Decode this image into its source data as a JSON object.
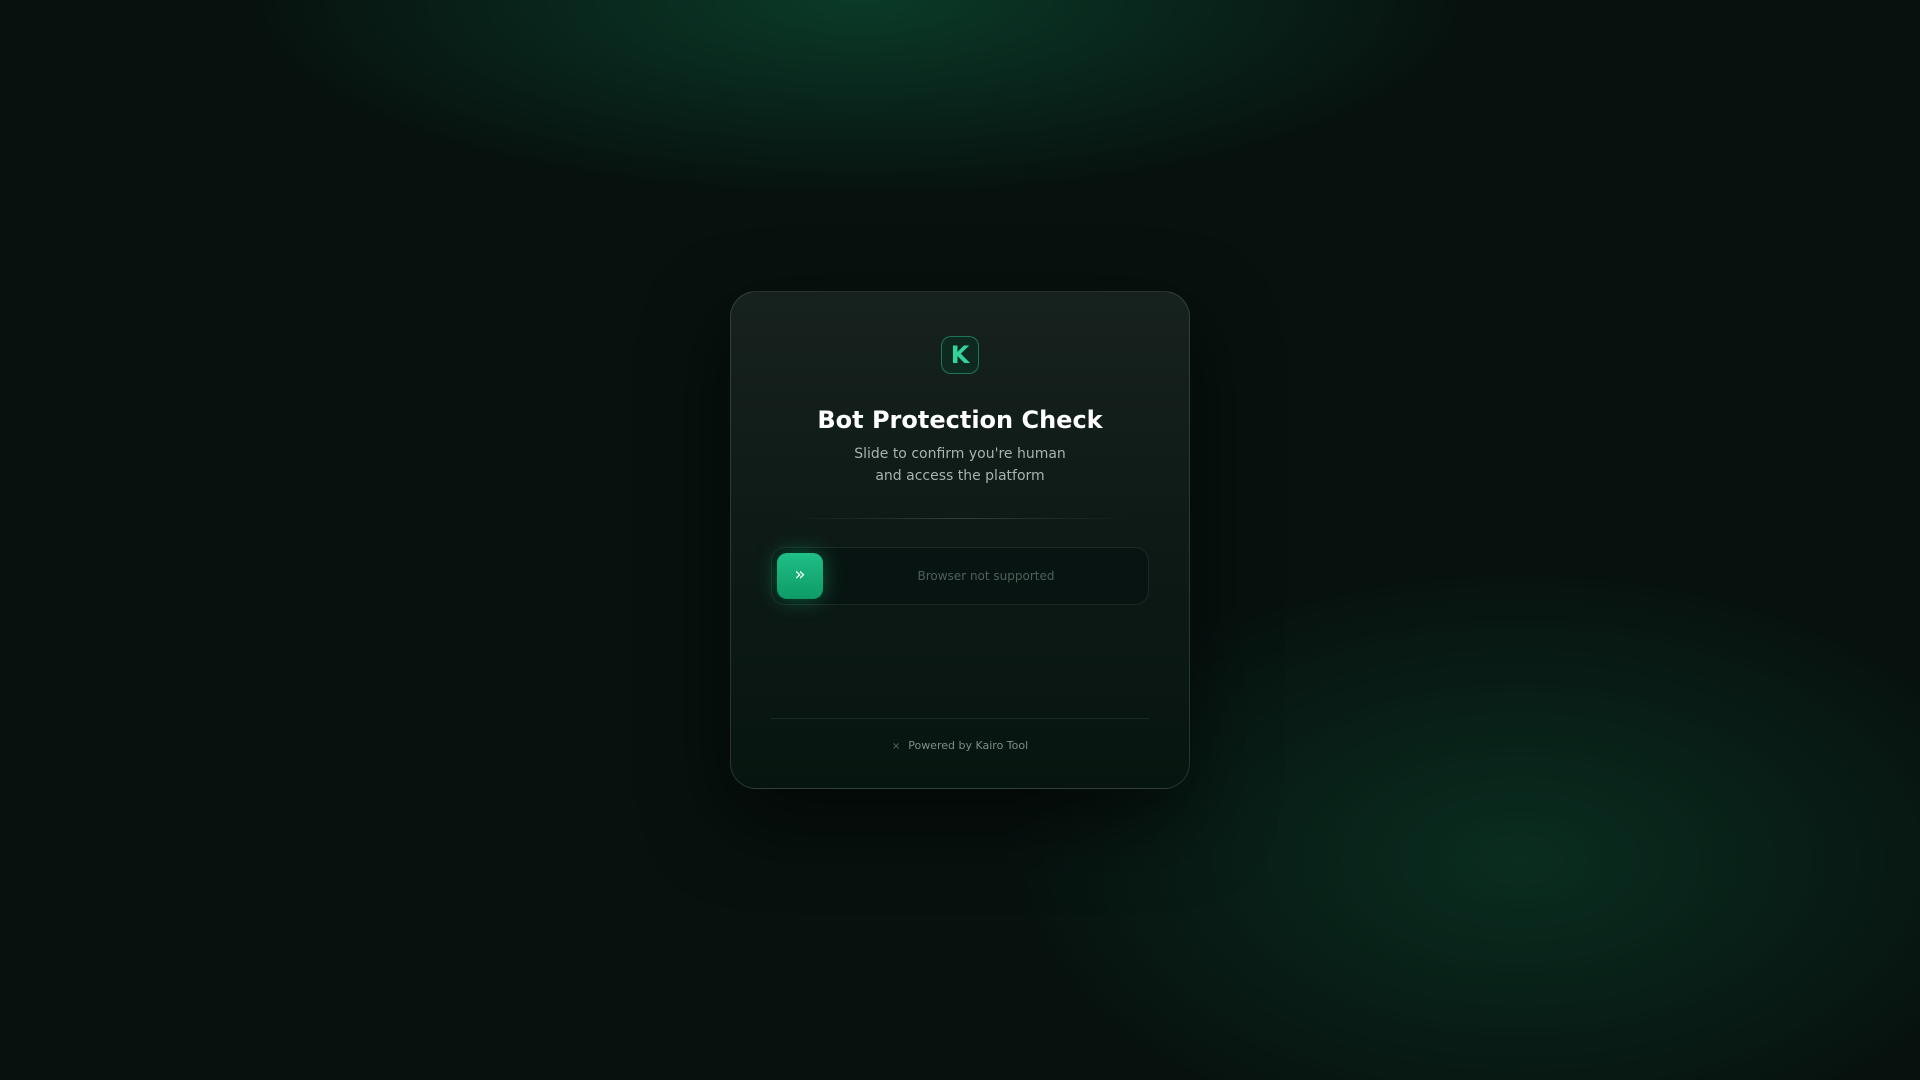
{
  "logo": {
    "letter": "K"
  },
  "header": {
    "title": "Bot Protection Check",
    "subtitle_line1": "Slide to confirm you're human",
    "subtitle_line2": "and access the platform"
  },
  "slider": {
    "handle_glyph": "»",
    "status_text": "Browser not supported"
  },
  "footer": {
    "icon_glyph": "×",
    "text": "Powered by Kairo Tool"
  },
  "colors": {
    "accent": "#1fbf87",
    "logo_text": "#34d399",
    "background": "#07110e"
  }
}
